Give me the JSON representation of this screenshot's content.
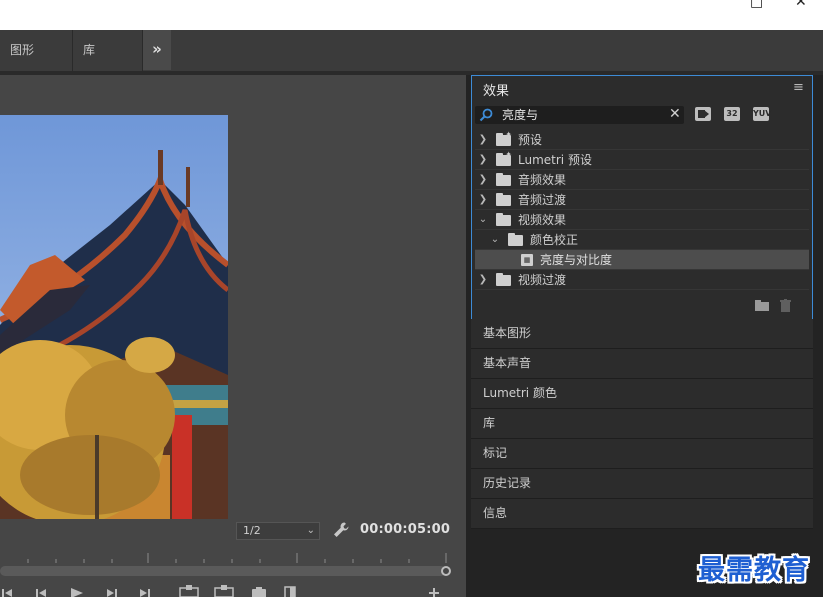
{
  "window": {
    "minimize_icon": "minimize-icon",
    "close_icon": "close-icon"
  },
  "tabs": [
    {
      "label": "图形"
    },
    {
      "label": "库"
    }
  ],
  "overflow_icon": "double-chevron-right-icon",
  "program_monitor": {
    "resolution": "1/2",
    "timecode": "00:00:05:00",
    "settings_icon": "wrench-icon"
  },
  "effects_panel": {
    "title": "效果",
    "menu_icon": "hamburger-menu-icon",
    "search": {
      "value": "亮度与",
      "icon": "search-icon",
      "clear_icon": "close-icon"
    },
    "filter_badges": [
      "加速效果",
      "32",
      "YUV"
    ],
    "tree": [
      {
        "label": "预设",
        "level": 0,
        "expanded": false,
        "kind": "folder-star"
      },
      {
        "label": "Lumetri 预设",
        "level": 0,
        "expanded": false,
        "kind": "folder-star"
      },
      {
        "label": "音频效果",
        "level": 0,
        "expanded": false,
        "kind": "folder"
      },
      {
        "label": "音频过渡",
        "level": 0,
        "expanded": false,
        "kind": "folder"
      },
      {
        "label": "视频效果",
        "level": 0,
        "expanded": true,
        "kind": "folder"
      },
      {
        "label": "颜色校正",
        "level": 1,
        "expanded": true,
        "kind": "folder"
      },
      {
        "label": "亮度与对比度",
        "level": 2,
        "expanded": false,
        "kind": "effect",
        "selected": true
      },
      {
        "label": "视频过渡",
        "level": 0,
        "expanded": false,
        "kind": "folder"
      }
    ],
    "footer_icons": [
      "new-bin-icon",
      "trash-icon"
    ]
  },
  "panels": [
    {
      "label": "基本图形"
    },
    {
      "label": "基本声音"
    },
    {
      "label": "Lumetri 颜色"
    },
    {
      "label": "库"
    },
    {
      "label": "标记"
    },
    {
      "label": "历史记录"
    },
    {
      "label": "信息"
    }
  ],
  "watermark": "最需教育",
  "colors": {
    "panel_bg": "#2c2c2c",
    "focus_border": "#3d8bd6",
    "selected_row": "#4d4d4d",
    "watermark": "#1e5fd2"
  }
}
